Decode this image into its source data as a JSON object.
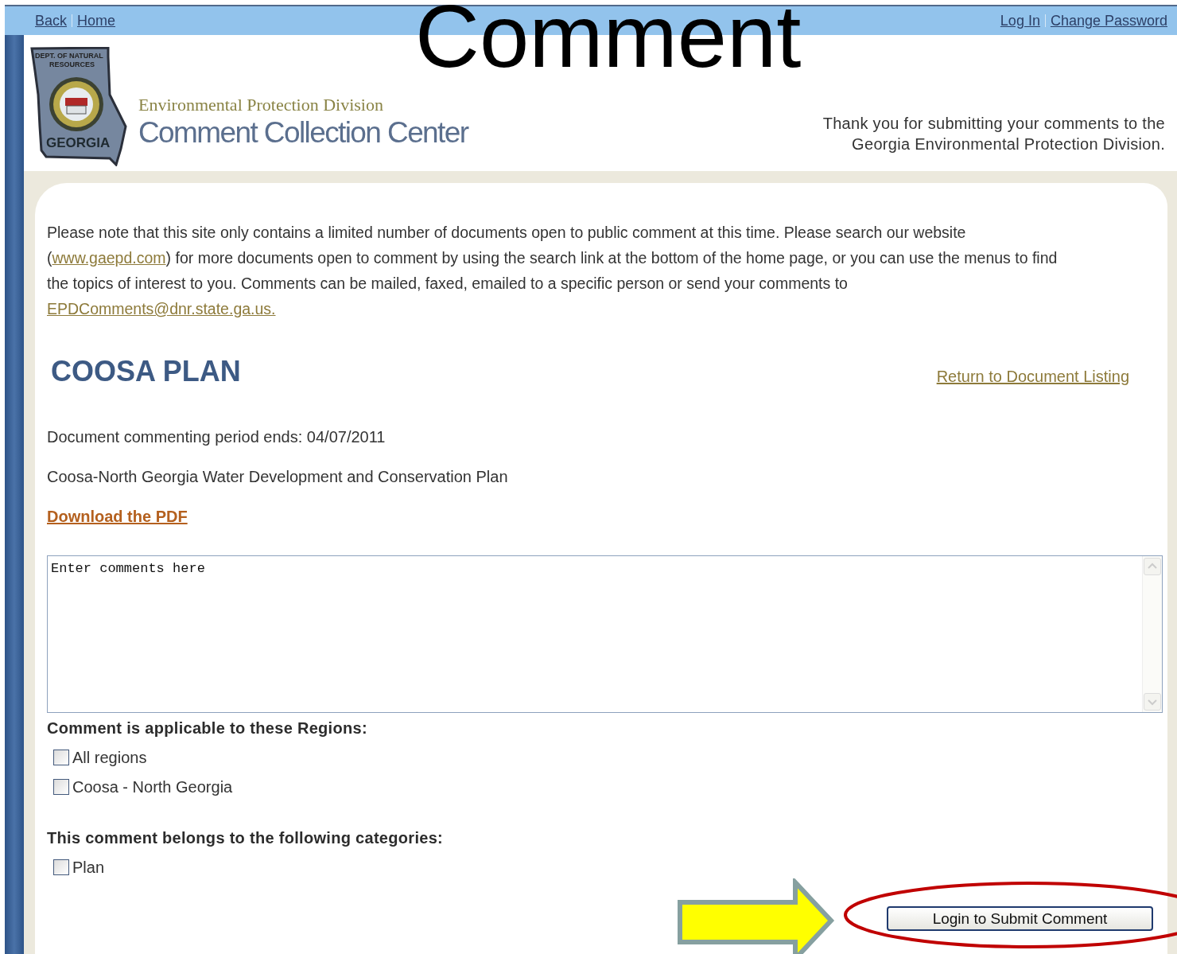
{
  "slide": {
    "title": "Comment"
  },
  "top_bar": {
    "left_links": [
      "Back",
      "Home"
    ],
    "right_links": [
      "Log In",
      "Change Password"
    ]
  },
  "header": {
    "logo": {
      "caption": [
        "DEPT. OF NATURAL",
        "RESOURCES"
      ],
      "label": "GEORGIA"
    },
    "division": "Environmental Protection Division",
    "site_title": "Comment Collection Center",
    "thank_you": [
      "Thank you for submitting your comments to the",
      "Georgia Environmental Protection Division."
    ]
  },
  "notice": [
    {
      "kind": "text",
      "text": "Please note that this site only contains a limited number of documents open to public comment at this time. Please search our website ("
    },
    {
      "kind": "link",
      "text": "www.gaepd.com"
    },
    {
      "kind": "text",
      "text": ") for more documents open to comment by using the search link at the bottom of the home page, or you can use the menus to find the topics of interest to you. Comments can be mailed, faxed, emailed to a specific person or send your comments to "
    },
    {
      "kind": "link",
      "text": "EPDComments@dnr.state.ga.us."
    }
  ],
  "document": {
    "title": "COOSA PLAN",
    "return_link": "Return to Document Listing",
    "period": "Document commenting period ends: 04/07/2011",
    "description": "Coosa-North Georgia Water Development and Conservation Plan",
    "download_link": "Download the PDF"
  },
  "comment_box": {
    "value": "Enter comments here"
  },
  "regions": {
    "label": "Comment is applicable to these Regions:",
    "options": [
      {
        "label": "All regions",
        "checked": false
      },
      {
        "label": "Coosa - North Georgia",
        "checked": false
      }
    ]
  },
  "categories": {
    "label": "This comment belongs to the following categories:",
    "options": [
      {
        "label": "Plan",
        "checked": false
      }
    ]
  },
  "submit_button": "Login to Submit Comment"
}
